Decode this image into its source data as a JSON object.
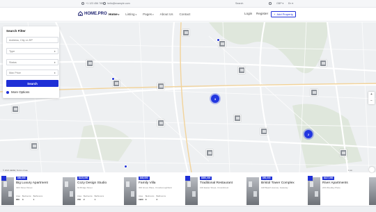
{
  "topbar": {
    "phone": "+1 123 456 789",
    "email": "hello@example.com",
    "search_placeholder": "Search",
    "currency": "GBP",
    "language": "En"
  },
  "header": {
    "logo": "HOME.PRO",
    "nav": [
      {
        "label": "Home",
        "chevron": "▾",
        "active": true
      },
      {
        "label": "Listing",
        "chevron": "▾",
        "active": false
      },
      {
        "label": "Pages",
        "chevron": "▾",
        "active": false
      },
      {
        "label": "About Us",
        "chevron": "",
        "active": false
      },
      {
        "label": "Contact",
        "chevron": "",
        "active": false
      }
    ],
    "login": "Login",
    "register": "Register",
    "add_property": "Add Property"
  },
  "filter": {
    "title": "Search Filter",
    "address_placeholder": "Address, City or ZIP",
    "type": "Type",
    "status": "Status",
    "max_price": "Max Price",
    "search_button": "Search",
    "more_options": "More Options"
  },
  "map": {
    "clusters": [
      "3",
      "2"
    ],
    "zoom_in": "+",
    "zoom_out": "−",
    "attribution": "© 2022 HERE | Terms of use",
    "scale": "1 km"
  },
  "listings": [
    {
      "price": "$80,000",
      "name": "Big Luxury Apartment",
      "address": "32th Street Street",
      "area": "850",
      "bedrooms": "3",
      "bathrooms": "1"
    },
    {
      "price": "$125,000",
      "name": "Cozy Design Studio",
      "address": "62 Bridge Street",
      "area": "720",
      "bedrooms": "2",
      "bathrooms": "1"
    },
    {
      "price": "$45,000",
      "name": "Family Villa",
      "address": "300 Grove Place, Crowboroughfield",
      "area": "1900",
      "bedrooms": "3",
      "bathrooms": "2"
    },
    {
      "price": "$850,000",
      "name": "Traditional Restaurant",
      "address": "100 Easter Street, Crownforest",
      "area": "",
      "bedrooms": "",
      "bathrooms": ""
    },
    {
      "price": "$50,000",
      "name": "Bristol Tower Complex",
      "address": "148 Beach Avenue, Gateway",
      "area": "",
      "bedrooms": "",
      "bathrooms": ""
    },
    {
      "price": "$137,000",
      "name": "River Apartments",
      "address": "223 Woodley Place",
      "area": "",
      "bedrooms": "",
      "bathrooms": ""
    }
  ],
  "spec_labels": {
    "area": "Area",
    "bedrooms": "Bedrooms",
    "bathrooms": "Bathrooms"
  },
  "colors": {
    "accent": "#1e2fd6",
    "brand": "#1a1f6e",
    "map_bg": "#eef0f2"
  }
}
